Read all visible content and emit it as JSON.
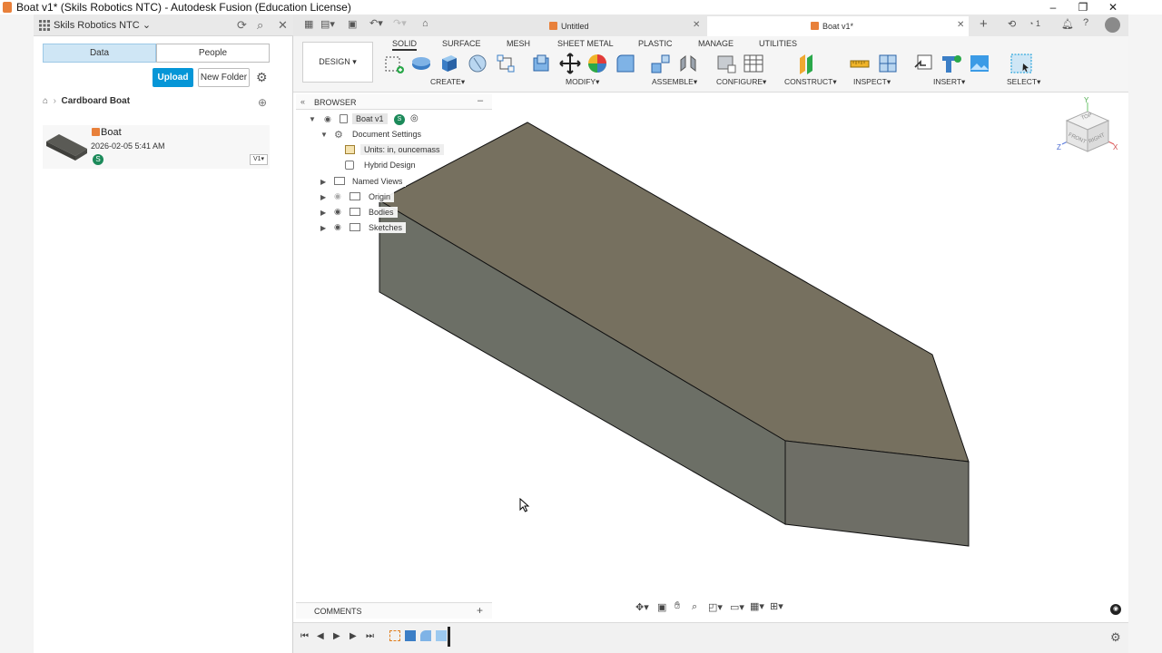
{
  "window": {
    "title": "Boat v1* (Skils Robotics NTC) - Autodesk Fusion (Education License)"
  },
  "data_panel": {
    "team_name": "Skils Robotics NTC",
    "tabs": [
      {
        "label": "Data"
      },
      {
        "label": "People"
      }
    ],
    "upload_label": "Upload",
    "new_folder_label": "New Folder",
    "breadcrumb": "Cardboard Boat",
    "file": {
      "name": "Boat",
      "date": "2026-02-05 5:41 AM",
      "owner_badge": "S",
      "version": "V1"
    }
  },
  "doc_tabs": [
    {
      "label": "Untitled"
    },
    {
      "label": "Boat v1*"
    }
  ],
  "header_right": {
    "job_count": "1"
  },
  "toolbar": {
    "workspace": "DESIGN",
    "tabs": [
      "SOLID",
      "SURFACE",
      "MESH",
      "SHEET METAL",
      "PLASTIC",
      "MANAGE",
      "UTILITIES"
    ],
    "groups": [
      "CREATE",
      "MODIFY",
      "ASSEMBLE",
      "CONFIGURE",
      "CONSTRUCT",
      "INSPECT",
      "INSERT",
      "SELECT"
    ]
  },
  "browser": {
    "title": "BROWSER",
    "root": "Boat v1",
    "items": [
      {
        "label": "Document Settings"
      },
      {
        "label": "Units: in, ouncemass"
      },
      {
        "label": "Hybrid Design"
      },
      {
        "label": "Named Views"
      },
      {
        "label": "Origin"
      },
      {
        "label": "Bodies"
      },
      {
        "label": "Sketches"
      }
    ]
  },
  "viewcube": {
    "top": "TOP",
    "front": "FRONT",
    "right": "RIGHT",
    "axis_x": "X",
    "axis_y": "Y",
    "axis_z": "Z"
  },
  "comments": {
    "title": "COMMENTS"
  },
  "colors": {
    "accent": "#0696d7",
    "body_top": "#75715f",
    "body_side": "#6c6f66"
  }
}
